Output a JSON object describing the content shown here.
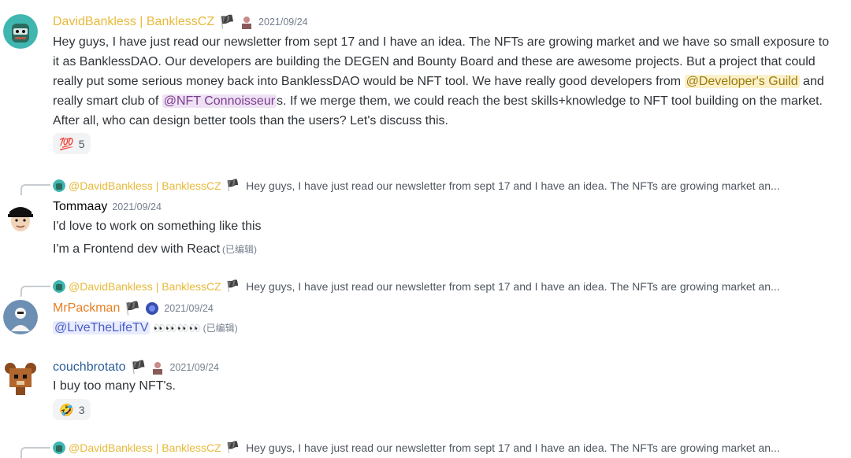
{
  "messages": [
    {
      "author": "DavidBankless | BanklessCZ",
      "timestamp": "2021/09/24",
      "author_color": "#e7b93a",
      "text_parts": {
        "p1": "Hey guys, I have just read our newsletter from sept 17 and I have an idea. The NFTs are growing market and we have so small exposure to it as BanklessDAO. Our developers are building the DEGEN and Bounty Board and these are awesome projects. But a project that could really put some serious money back into BanklessDAO would be NFT tool. We have really good developers from ",
        "mention1": "@Developer's Guild",
        "p2": " and really smart club of ",
        "mention2": "@NFT Connoisseur",
        "p3": "s. If we merge them, we could reach the best skills+knowledge to NFT tool building on the market. After all, who can design better tools than the users? Let's discuss this."
      },
      "reaction": {
        "emoji": "💯",
        "count": "5"
      }
    },
    {
      "reply_to": {
        "name": "@DavidBankless | BanklessCZ",
        "snippet": "Hey guys, I have just read our newsletter from sept 17 and I have an idea. The NFTs are growing market an..."
      },
      "author": "Tommaay",
      "timestamp": "2021/09/24",
      "lines": [
        "I'd love to work on something like this",
        "I'm a Frontend dev with React"
      ],
      "edited": "(已编辑)"
    },
    {
      "reply_to": {
        "name": "@DavidBankless | BanklessCZ",
        "snippet": "Hey guys, I have just read our newsletter from sept 17 and I have an idea. The NFTs are growing market an..."
      },
      "author": "MrPackman",
      "author_color": "#e67e22",
      "timestamp": "2021/09/24",
      "mention": "@LiveTheLifeTV",
      "eyes": "👀👀👀👀",
      "edited": "(已编辑)"
    },
    {
      "author": "couchbrotato",
      "timestamp": "2021/09/24",
      "text": "I buy too many NFT's.",
      "reaction": {
        "emoji": "🤣",
        "count": "3"
      }
    },
    {
      "reply_to": {
        "name": "@DavidBankless | BanklessCZ",
        "snippet": "Hey guys, I have just read our newsletter from sept 17 and I have an idea. The NFTs are growing market an..."
      }
    }
  ],
  "icons": {
    "flag": "🏴",
    "hundred": "💯",
    "rofl": "🤣",
    "eyes": "👀"
  }
}
